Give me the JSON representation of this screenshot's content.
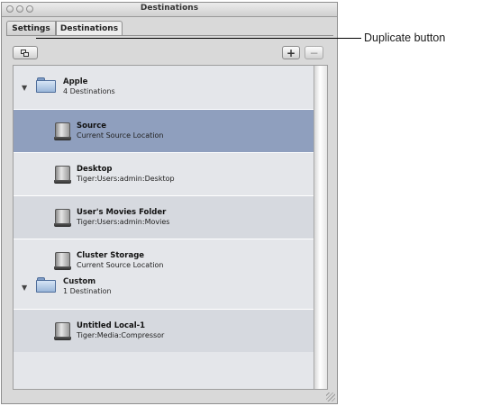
{
  "window": {
    "title": "Destinations"
  },
  "tabs": [
    {
      "label": "Settings"
    },
    {
      "label": "Destinations"
    }
  ],
  "toolbar": {
    "duplicate_icon": "duplicate-icon",
    "add_label": "+",
    "remove_label": "−"
  },
  "groups": [
    {
      "name": "Apple",
      "count": "4 Destinations",
      "destinations": [
        {
          "name": "Source",
          "path": "Current Source Location",
          "selected": true
        },
        {
          "name": "Desktop",
          "path": "Tiger:Users:admin:Desktop"
        },
        {
          "name": "User's Movies Folder",
          "path": "Tiger:Users:admin:Movies"
        },
        {
          "name": "Cluster Storage",
          "path": "Current Source Location"
        }
      ]
    },
    {
      "name": "Custom",
      "count": "1 Destination",
      "destinations": [
        {
          "name": "Untitled Local-1",
          "path": "Tiger:Media:Compressor"
        }
      ]
    }
  ],
  "callout": {
    "label": "Duplicate button"
  },
  "colors": {
    "selected_row": "#8f9fbe",
    "list_bg": "#e4e6ea",
    "alt_row": "#d6d9df"
  }
}
